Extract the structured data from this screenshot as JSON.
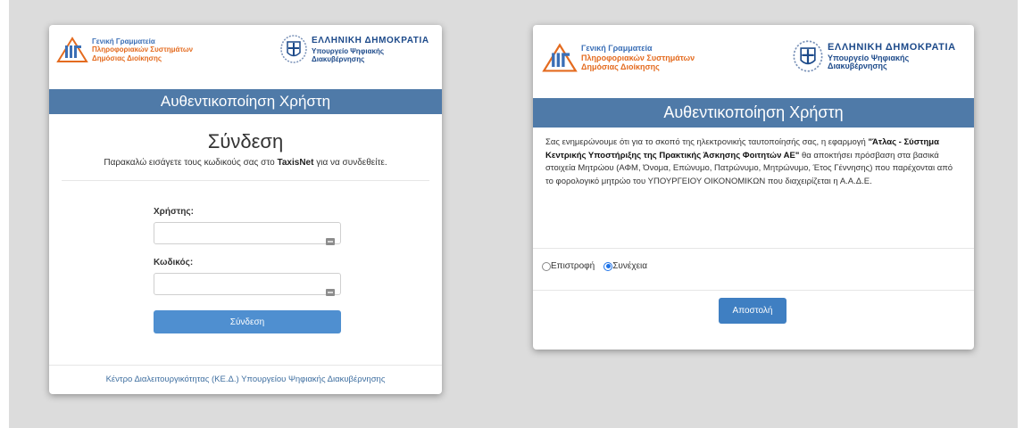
{
  "auth_card": {
    "logo_gsis": {
      "line1": "Γενική Γραμματεία",
      "line2": "Πληροφοριακών Συστημάτων",
      "line3": "Δημόσιας Διοίκησης"
    },
    "logo_greece": {
      "line1": "ΕΛΛΗΝΙΚΗ ΔΗΜΟΚΡΑΤΙΑ",
      "line2": "Υπουργείο Ψηφιακής",
      "line3": "Διακυβέρνησης"
    },
    "title": "Αυθεντικοποίηση Χρήστη",
    "heading": "Σύνδεση",
    "subtext_prefix": "Παρακαλώ εισάγετε τους κωδικούς σας στο ",
    "subtext_strong": "TaxisNet",
    "subtext_suffix": " για να συνδεθείτε.",
    "username_label": "Χρήστης:",
    "username_value": "",
    "password_label": "Κωδικός:",
    "password_value": "",
    "submit_label": "Σύνδεση",
    "footer_link": "Κέντρο Διαλειτουργικότητας (ΚΕ.Δ.) Υπουργείου Ψηφιακής Διακυβέρνησης"
  },
  "consent_card": {
    "title": "Αυθεντικοποίηση Χρήστη",
    "text_part1": "Σας ενημερώνουμε ότι για το σκοπό της ηλεκτρονικής ταυτοποίησής σας, η εφαρμογή ",
    "text_app_name": "\"Άτλας - Σύστημα Κεντρικής Υποστήριξης της Πρακτικής Άσκησης Φοιτητών ΑΕ\"",
    "text_part2": " θα αποκτήσει πρόσβαση στα βασικά στοιχεία Μητρώου (ΑΦΜ, Όνομα, Επώνυμο, Πατρώνυμο, Μητρώνυμο, Έτος Γέννησης) που παρέχονται από το φορολογικό μητρώο του ΥΠΟΥΡΓΕΙΟΥ ΟΙΚΟΝΟΜΙΚΩΝ που διαχειρίζεται η Α.Α.Δ.Ε.",
    "radio_back_label": "Επιστροφή",
    "radio_continue_label": "Συνέχεια",
    "selected": "Συνέχεια",
    "send_label": "Αποστολή"
  },
  "colors": {
    "title_bar": "#4f7aa8",
    "primary_button": "#4f8fd0",
    "link": "#3f6fa0"
  }
}
